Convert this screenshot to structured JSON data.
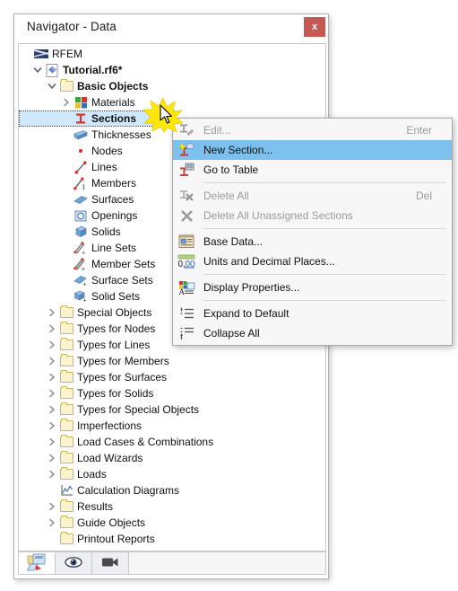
{
  "window": {
    "title": "Navigator - Data",
    "close_label": "x"
  },
  "tree": {
    "nodes": [
      {
        "label": "RFEM",
        "indent": 0,
        "icon": "rfem-flag-icon",
        "expander": "none",
        "bold": false,
        "selected": false
      },
      {
        "label": "Tutorial.rf6*",
        "indent": 1,
        "icon": "model-file-icon",
        "expander": "open",
        "bold": true,
        "selected": false
      },
      {
        "label": "Basic Objects",
        "indent": 2,
        "icon": "folder-icon",
        "expander": "open",
        "bold": true,
        "selected": false
      },
      {
        "label": "Materials",
        "indent": 3,
        "icon": "materials-icon",
        "expander": "closed",
        "bold": false,
        "selected": false
      },
      {
        "label": "Sections",
        "indent": 3,
        "icon": "section-icon",
        "expander": "none",
        "bold": true,
        "selected": true
      },
      {
        "label": "Thicknesses",
        "indent": 3,
        "icon": "thickness-icon",
        "expander": "none",
        "bold": false,
        "selected": false
      },
      {
        "label": "Nodes",
        "indent": 3,
        "icon": "node-icon",
        "expander": "none",
        "bold": false,
        "selected": false
      },
      {
        "label": "Lines",
        "indent": 3,
        "icon": "line-icon",
        "expander": "none",
        "bold": false,
        "selected": false
      },
      {
        "label": "Members",
        "indent": 3,
        "icon": "member-icon",
        "expander": "none",
        "bold": false,
        "selected": false
      },
      {
        "label": "Surfaces",
        "indent": 3,
        "icon": "surface-icon",
        "expander": "none",
        "bold": false,
        "selected": false
      },
      {
        "label": "Openings",
        "indent": 3,
        "icon": "opening-icon",
        "expander": "none",
        "bold": false,
        "selected": false
      },
      {
        "label": "Solids",
        "indent": 3,
        "icon": "solid-icon",
        "expander": "none",
        "bold": false,
        "selected": false
      },
      {
        "label": "Line Sets",
        "indent": 3,
        "icon": "line-set-icon",
        "expander": "none",
        "bold": false,
        "selected": false
      },
      {
        "label": "Member Sets",
        "indent": 3,
        "icon": "member-set-icon",
        "expander": "none",
        "bold": false,
        "selected": false
      },
      {
        "label": "Surface Sets",
        "indent": 3,
        "icon": "surface-set-icon",
        "expander": "none",
        "bold": false,
        "selected": false
      },
      {
        "label": "Solid Sets",
        "indent": 3,
        "icon": "solid-set-icon",
        "expander": "none",
        "bold": false,
        "selected": false
      },
      {
        "label": "Special Objects",
        "indent": 2,
        "icon": "folder-icon",
        "expander": "closed",
        "bold": false,
        "selected": false
      },
      {
        "label": "Types for Nodes",
        "indent": 2,
        "icon": "folder-icon",
        "expander": "closed",
        "bold": false,
        "selected": false
      },
      {
        "label": "Types for Lines",
        "indent": 2,
        "icon": "folder-icon",
        "expander": "closed",
        "bold": false,
        "selected": false
      },
      {
        "label": "Types for Members",
        "indent": 2,
        "icon": "folder-icon",
        "expander": "closed",
        "bold": false,
        "selected": false
      },
      {
        "label": "Types for Surfaces",
        "indent": 2,
        "icon": "folder-icon",
        "expander": "closed",
        "bold": false,
        "selected": false
      },
      {
        "label": "Types for Solids",
        "indent": 2,
        "icon": "folder-icon",
        "expander": "closed",
        "bold": false,
        "selected": false
      },
      {
        "label": "Types for Special Objects",
        "indent": 2,
        "icon": "folder-icon",
        "expander": "closed",
        "bold": false,
        "selected": false
      },
      {
        "label": "Imperfections",
        "indent": 2,
        "icon": "folder-icon",
        "expander": "closed",
        "bold": false,
        "selected": false
      },
      {
        "label": "Load Cases & Combinations",
        "indent": 2,
        "icon": "folder-icon",
        "expander": "closed",
        "bold": false,
        "selected": false
      },
      {
        "label": "Load Wizards",
        "indent": 2,
        "icon": "folder-icon",
        "expander": "closed",
        "bold": false,
        "selected": false
      },
      {
        "label": "Loads",
        "indent": 2,
        "icon": "folder-icon",
        "expander": "closed",
        "bold": false,
        "selected": false
      },
      {
        "label": "Calculation Diagrams",
        "indent": 2,
        "icon": "diagram-icon",
        "expander": "none",
        "bold": false,
        "selected": false
      },
      {
        "label": "Results",
        "indent": 2,
        "icon": "folder-icon",
        "expander": "closed",
        "bold": false,
        "selected": false
      },
      {
        "label": "Guide Objects",
        "indent": 2,
        "icon": "folder-icon",
        "expander": "closed",
        "bold": false,
        "selected": false
      },
      {
        "label": "Printout Reports",
        "indent": 2,
        "icon": "folder-icon",
        "expander": "none",
        "bold": false,
        "selected": false
      }
    ]
  },
  "tabs": [
    {
      "name": "navigator-data-tab",
      "icon": "data-navigator-icon",
      "active": true
    },
    {
      "name": "navigator-display-tab",
      "icon": "eye-icon",
      "active": false
    },
    {
      "name": "navigator-views-tab",
      "icon": "camera-icon",
      "active": false
    }
  ],
  "context_menu": {
    "items": [
      {
        "label": "Edit...",
        "shortcut": "Enter",
        "icon": "edit-section-icon",
        "disabled": true,
        "highlight": false,
        "separator_after": false
      },
      {
        "label": "New Section...",
        "shortcut": "",
        "icon": "new-section-icon",
        "disabled": false,
        "highlight": true,
        "separator_after": false
      },
      {
        "label": "Go to Table",
        "shortcut": "",
        "icon": "go-to-table-icon",
        "disabled": false,
        "highlight": false,
        "separator_after": true
      },
      {
        "label": "Delete All",
        "shortcut": "Del",
        "icon": "delete-all-icon",
        "disabled": true,
        "highlight": false,
        "separator_after": false
      },
      {
        "label": "Delete All Unassigned Sections",
        "shortcut": "",
        "icon": "delete-unassigned-icon",
        "disabled": true,
        "highlight": false,
        "separator_after": true
      },
      {
        "label": "Base Data...",
        "shortcut": "",
        "icon": "base-data-icon",
        "disabled": false,
        "highlight": false,
        "separator_after": false
      },
      {
        "label": "Units and Decimal Places...",
        "shortcut": "",
        "icon": "units-decimals-icon",
        "disabled": false,
        "highlight": false,
        "separator_after": true
      },
      {
        "label": "Display Properties...",
        "shortcut": "",
        "icon": "display-properties-icon",
        "disabled": false,
        "highlight": false,
        "separator_after": true
      },
      {
        "label": "Expand to Default",
        "shortcut": "",
        "icon": "expand-default-icon",
        "disabled": false,
        "highlight": false,
        "separator_after": false
      },
      {
        "label": "Collapse All",
        "shortcut": "",
        "icon": "collapse-all-icon",
        "disabled": false,
        "highlight": false,
        "separator_after": false
      }
    ]
  },
  "colors": {
    "selection_blue": "#cfe8fb",
    "menu_highlight": "#7cc0ee",
    "close_red": "#c55a55",
    "folder_yellow": "#fbf3cd",
    "burst_yellow": "#ffe808"
  }
}
